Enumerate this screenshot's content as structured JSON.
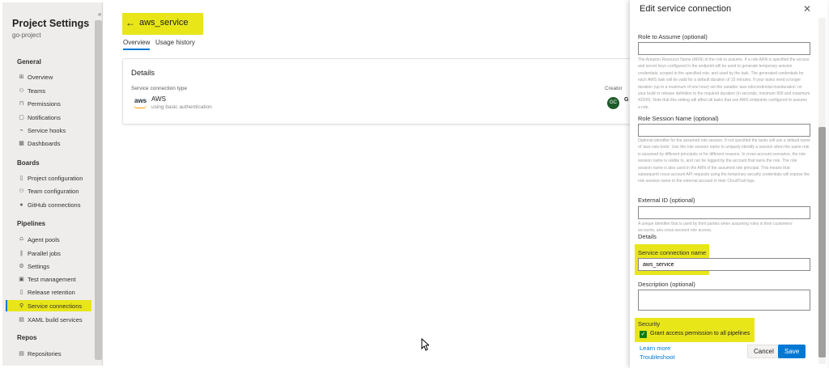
{
  "sidebar": {
    "title": "Project Settings",
    "subtitle": "go-project",
    "collapse_glyph": "«",
    "sections": {
      "general": "General",
      "boards": "Boards",
      "pipelines": "Pipelines",
      "repos": "Repos"
    },
    "items": {
      "overview": "Overview",
      "teams": "Teams",
      "permissions": "Permissions",
      "notifications": "Notifications",
      "service_hooks": "Service hooks",
      "dashboards": "Dashboards",
      "project_configuration": "Project configuration",
      "team_configuration": "Team configuration",
      "github_connections": "GitHub connections",
      "agent_pools": "Agent pools",
      "parallel_jobs": "Parallel jobs",
      "settings": "Settings",
      "test_management": "Test management",
      "release_retention": "Release retention",
      "service_connections": "Service connections",
      "xaml_build_services": "XAML build services",
      "repositories": "Repositories"
    },
    "active_item": "Service connections"
  },
  "main": {
    "title": "aws_service",
    "tabs": {
      "overview": "Overview",
      "usage_history": "Usage history"
    },
    "active_tab": "Overview",
    "details": {
      "title": "Details",
      "type_label": "Service connection type",
      "logo_text": "aws",
      "type_name": "AWS",
      "auth": "using basic authentication",
      "creator_label": "Creator",
      "creator_avatar": "GC",
      "creator_name_visible": "G"
    }
  },
  "panel": {
    "title": "Edit service connection",
    "role_to_assume": {
      "label": "Role to Assume (optional)",
      "value": "",
      "help": "The Amazon Resource Name (ARN) of the role to assume. If a role ARN is specified the access and secret keys configured in the endpoint will be used to generate temporary session credentials, scoped to the specified role, and used by the task. The generated credentials for each AWS task will be valid for a default duration of 15 minutes. If your tasks need a longer duration (up to a maximum of one hour) set the variable 'aws.rolecredential.maxduration' on your build or release definition to the required duration (in seconds, minimum 900 and maximum 43200). Note that this setting will affect all tasks that use AWS endpoints configured to assume a role."
    },
    "role_session_name": {
      "label": "Role Session Name (optional)",
      "value": "",
      "help": "Optional identifier for the assumed role session. If not specified the tasks will use a default name of 'aws-vsts-tools'. Use the role session name to uniquely identify a session when the same role is assumed by different principals or for different reasons. In cross-account scenarios, the role session name is visible to, and can be logged by the account that owns the role. The role session name is also used in the ARN of the assumed role principal. This means that subsequent cross-account API requests using the temporary security credentials will expose the role session name to the external account in their CloudTrail logs."
    },
    "external_id": {
      "label": "External ID (optional)",
      "value": "",
      "help": "A unique identifier that is used by third parties when assuming roles in their customers' accounts, aka cross-account role access."
    },
    "details_heading": "Details",
    "connection_name": {
      "label": "Service connection name",
      "value": "aws_service"
    },
    "description": {
      "label": "Description (optional)",
      "value": ""
    },
    "security": {
      "heading": "Security",
      "grant_access_label": "Grant access permission to all pipelines",
      "grant_access_checked": true
    },
    "links": {
      "learn_more": "Learn more",
      "troubleshoot": "Troubleshoot"
    },
    "buttons": {
      "cancel": "Cancel",
      "save": "Save"
    }
  },
  "colors": {
    "highlight": "#e8e619",
    "accent": "#0078d4",
    "check": "#107c10",
    "avatar": "#1e5c2a"
  }
}
